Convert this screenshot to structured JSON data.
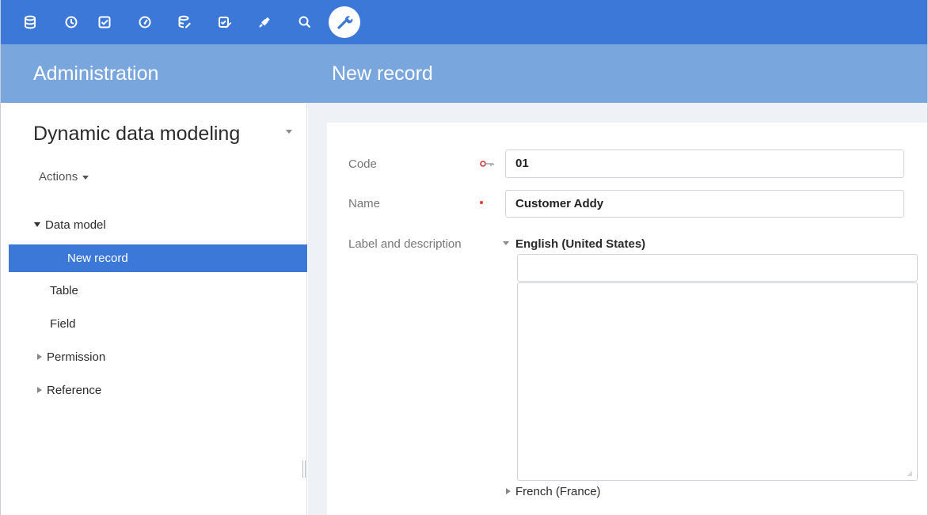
{
  "toolbar": {
    "icons": [
      "database-icon",
      "history-icon",
      "tasks-icon",
      "dashboard-icon",
      "data-edit-icon",
      "workflow-icon",
      "plugin-icon",
      "search-icon",
      "admin-wrench-icon"
    ],
    "active_icon": "admin-wrench-icon",
    "colors": {
      "bar": "#3b78d8",
      "title_band": "#7aa6de",
      "selected": "#3b78d8"
    }
  },
  "header": {
    "section_title": "Administration",
    "page_title": "New record"
  },
  "sidebar": {
    "title": "Dynamic data modeling",
    "actions_label": "Actions",
    "tree": [
      {
        "label": "Data model",
        "state": "expanded"
      },
      {
        "label": "New record",
        "state": "selected"
      },
      {
        "label": "Table",
        "state": "leaf"
      },
      {
        "label": "Field",
        "state": "leaf"
      },
      {
        "label": "Permission",
        "state": "collapsed"
      },
      {
        "label": "Reference",
        "state": "collapsed"
      }
    ]
  },
  "form": {
    "code": {
      "label": "Code",
      "value": "01",
      "marker": "key-icon"
    },
    "name": {
      "label": "Name",
      "value": "Customer Addy",
      "marker": "required-icon"
    },
    "label_description": {
      "label": "Label and description",
      "languages": [
        {
          "name": "English (United States)",
          "state": "expanded",
          "label_value": "",
          "description_value": ""
        },
        {
          "name": "French (France)",
          "state": "collapsed"
        }
      ]
    }
  }
}
